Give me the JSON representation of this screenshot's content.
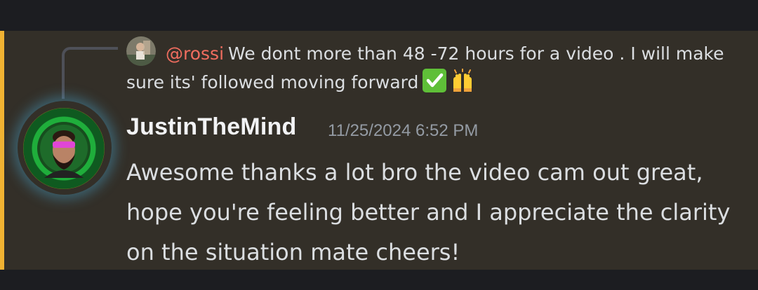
{
  "reply": {
    "author": "@rossi",
    "text": "We dont more than 48 -72 hours for a video . I will make sure its' followed moving forward",
    "emojis": [
      "check-mark-button-emoji",
      "raising-hands-emoji"
    ]
  },
  "message": {
    "author": "JustinTheMind",
    "timestamp": "11/25/2024 6:52 PM",
    "content": "Awesome thanks a lot bro the video cam out great, hope you're feeling better and I appreciate the clarity on the situation mate cheers!"
  },
  "colors": {
    "background": "#332f28",
    "mention_bar": "#f0b232",
    "reply_author": "#f06d5f",
    "text": "#dbdee1",
    "username": "#f2f3f5",
    "timestamp": "#949ba4"
  }
}
